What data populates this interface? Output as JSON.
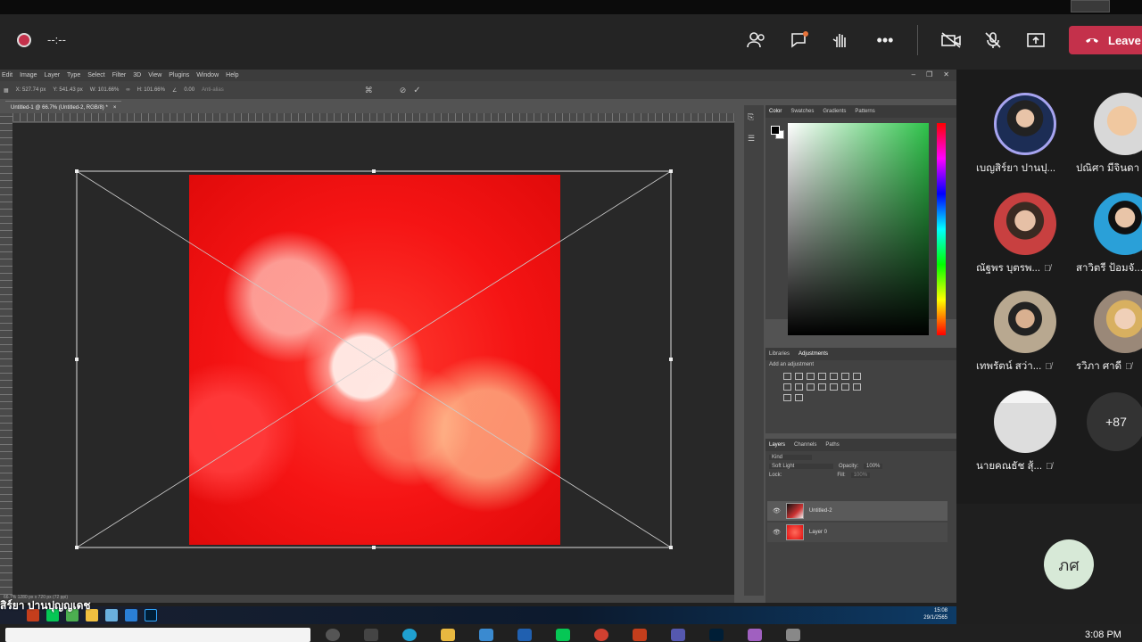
{
  "meeting": {
    "timer": "--:--",
    "leave_label": "Leave",
    "icons": [
      "people-icon",
      "chat-icon",
      "react-icon",
      "more-icon",
      "camera-off-icon",
      "mic-off-icon",
      "share-icon",
      "phone-icon"
    ]
  },
  "photoshop": {
    "menu": [
      "Edit",
      "Image",
      "Layer",
      "Type",
      "Select",
      "Filter",
      "3D",
      "View",
      "Plugins",
      "Window",
      "Help"
    ],
    "options": {
      "x": "X: 527.74 px",
      "y": "Y: 541.43 px",
      "w": "W: 101.66%",
      "h": "H: 101.66%",
      "angle": "0.00",
      "antialias": "Anti-alias"
    },
    "doc_tab": "Untitled-1 @ 66.7% (Untitled-2, RGB/8) *",
    "status_text": "66.7%   1280 px x 720 px (72 ppi)",
    "color_panel": {
      "tabs": [
        "Color",
        "Swatches",
        "Gradients",
        "Patterns"
      ],
      "active": "Color"
    },
    "adjust_panel": {
      "tabs": [
        "Libraries",
        "Adjustments"
      ],
      "active": "Adjustments",
      "hint": "Add an adjustment"
    },
    "layers_panel": {
      "tabs": [
        "Layers",
        "Channels",
        "Paths"
      ],
      "active": "Layers",
      "kind_placeholder": "Kind",
      "blend_mode": "Soft Light",
      "opacity_label": "Opacity:",
      "opacity": "100%",
      "lock_label": "Lock:",
      "fill_label": "Fill:",
      "fill": "100%",
      "layers": [
        {
          "name": "Untitled-2",
          "selected": true
        },
        {
          "name": "Layer 0",
          "selected": false
        }
      ]
    }
  },
  "participants": [
    {
      "name": "เบญสิร์ยา ปานปุ...",
      "muted": false
    },
    {
      "name": "ปณิศา มีจินดา",
      "muted": false
    },
    {
      "name": "ณัฐพร บุตรพ...",
      "muted": true
    },
    {
      "name": "สาวิตรี ป้อมจั...",
      "muted": true
    },
    {
      "name": "เทพรัตน์ สว่า...",
      "muted": true
    },
    {
      "name": "รวิภา ศาดี",
      "muted": true
    },
    {
      "name": "นายคณธัช สุ้...",
      "muted": true
    }
  ],
  "more_count": "+87",
  "self_initials": "ภศ",
  "caption": "สิร์ยา ปานปุญญเดช",
  "win_taskbar_clock": {
    "time": "15:08",
    "date": "29/1/2565"
  },
  "system_clock": "3:08 PM"
}
